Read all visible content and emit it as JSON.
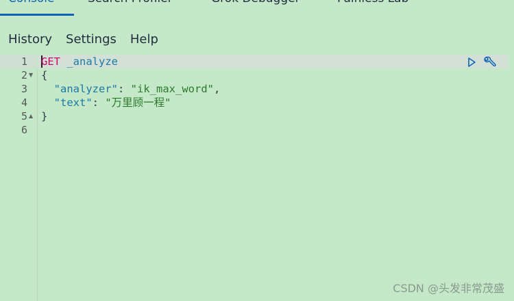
{
  "tabs": {
    "items": [
      "Console",
      "Search Profiler",
      "Grok Debugger",
      "Painless Lab"
    ],
    "active": 0
  },
  "menu": {
    "history": "History",
    "settings": "Settings",
    "help": "Help"
  },
  "editor": {
    "line_numbers": [
      "1",
      "2",
      "3",
      "4",
      "5",
      "6"
    ],
    "line1": {
      "method": "GET",
      "path": "_analyze"
    },
    "line2": {
      "brace": "{"
    },
    "line3": {
      "key": "\"analyzer\"",
      "colon": ": ",
      "value": "\"ik_max_word\"",
      "comma": ","
    },
    "line4": {
      "key": "\"text\"",
      "colon": ": ",
      "value": "\"万里顾一程\""
    },
    "line5": {
      "brace": "}"
    },
    "actions": {
      "run": "play-icon",
      "settings": "wrench-icon"
    }
  },
  "watermark": "CSDN @头发非常茂盛",
  "colors": {
    "background": "#c5e8c9",
    "accent": "#0b64b4",
    "method": "#c80a68",
    "key": "#1a79a6",
    "string": "#2a7a2a"
  }
}
